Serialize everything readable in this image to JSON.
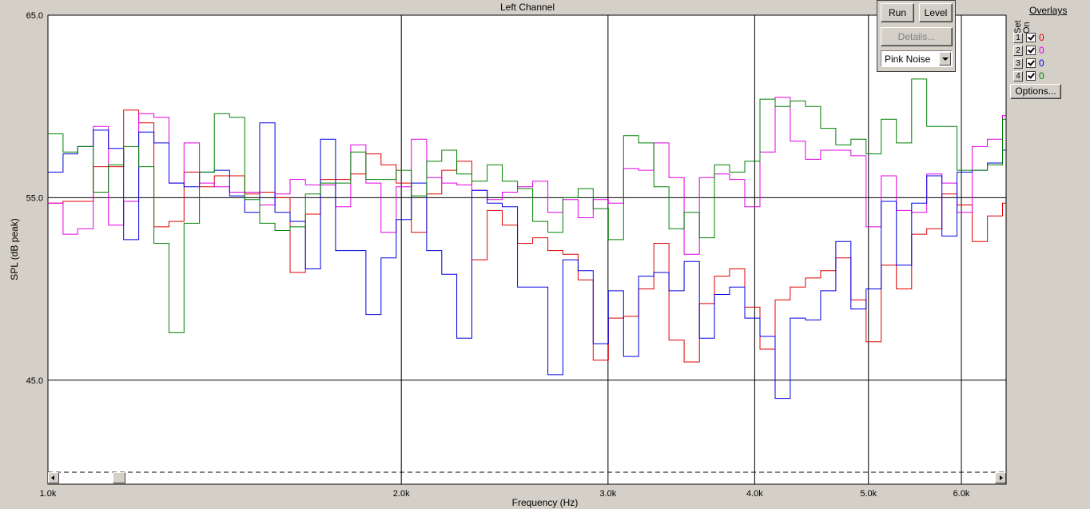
{
  "chart_title": "Left Channel",
  "controls": {
    "run_label": "Run",
    "level_label": "Level",
    "details_label": "Details...",
    "signal_value": "Pink Noise",
    "options_label": "Options..."
  },
  "overlays": {
    "title": "Overlays",
    "col_set": "Set",
    "col_on": "On",
    "rows": [
      {
        "num": "1",
        "count": "0",
        "color": "#e00000"
      },
      {
        "num": "2",
        "count": "0",
        "color": "#e000e0"
      },
      {
        "num": "3",
        "count": "0",
        "color": "#0000e0"
      },
      {
        "num": "4",
        "count": "0",
        "color": "#008000"
      }
    ]
  },
  "chart_data": {
    "type": "line",
    "title": "Left Channel",
    "xlabel": "Frequency (Hz)",
    "ylabel": "SPL (dB peak)",
    "x_scale": "log",
    "xlim": [
      1000,
      6550
    ],
    "ylim": [
      40.0,
      65.0
    ],
    "y_ticks": [
      "65.0",
      "55.0",
      "45.0"
    ],
    "x_ticks": [
      {
        "value": 1000,
        "label": "1.0k"
      },
      {
        "value": 2000,
        "label": "2.0k"
      },
      {
        "value": 3000,
        "label": "3.0k"
      },
      {
        "value": 4000,
        "label": "4.0k"
      },
      {
        "value": 5000,
        "label": "5.0k"
      },
      {
        "value": 6000,
        "label": "6.0k"
      }
    ],
    "grid": true,
    "x": [
      1000,
      1030,
      1060,
      1093,
      1126,
      1160,
      1195,
      1231,
      1268,
      1306,
      1346,
      1386,
      1428,
      1471,
      1515,
      1561,
      1608,
      1657,
      1707,
      1758,
      1811,
      1866,
      1922,
      1980,
      2040,
      2102,
      2165,
      2230,
      2297,
      2367,
      2438,
      2512,
      2588,
      2666,
      2746,
      2829,
      2914,
      3002,
      3093,
      3186,
      3282,
      3381,
      3483,
      3589,
      3697,
      3808,
      3923,
      4042,
      4164,
      4289,
      4419,
      4552,
      4690,
      4831,
      4977,
      5127,
      5282,
      5442,
      5606,
      5775,
      5949,
      6129,
      6314,
      6504
    ],
    "series": [
      {
        "name": "1",
        "color": "#e00000",
        "values": [
          54.7,
          54.8,
          54.8,
          56.7,
          56.7,
          59.8,
          59.1,
          53.4,
          53.7,
          56.4,
          55.6,
          56.2,
          56.2,
          55.2,
          55.3,
          55.0,
          50.9,
          54.1,
          56.0,
          56.0,
          56.3,
          57.4,
          56.8,
          55.8,
          53.1,
          55.2,
          56.5,
          57.0,
          51.6,
          54.3,
          53.5,
          52.5,
          52.8,
          52.1,
          51.9,
          50.5,
          46.1,
          48.4,
          48.5,
          50.0,
          52.5,
          47.2,
          46.0,
          49.2,
          50.7,
          51.1,
          49.0,
          46.7,
          49.4,
          50.1,
          50.6,
          51.0,
          51.7,
          49.4,
          47.1,
          51.3,
          50.0,
          53.0,
          53.3,
          55.2,
          54.6,
          52.6,
          54.0,
          54.7,
          55.1,
          56.6,
          57.1,
          57.6
        ]
      },
      {
        "name": "2",
        "color": "#e000e0",
        "values": [
          54.7,
          53.0,
          53.3,
          58.9,
          53.5,
          54.8,
          59.6,
          59.4,
          55.8,
          58.0,
          55.8,
          55.6,
          55.3,
          55.3,
          54.6,
          55.2,
          56.0,
          55.7,
          55.7,
          54.5,
          57.9,
          55.8,
          53.1,
          55.6,
          58.2,
          56.1,
          55.8,
          55.7,
          55.4,
          54.9,
          55.3,
          55.6,
          55.9,
          54.2,
          54.9,
          53.9,
          54.9,
          54.7,
          56.6,
          56.5,
          58.0,
          56.1,
          51.9,
          56.1,
          56.3,
          56.0,
          54.5,
          57.5,
          60.5,
          58.1,
          57.1,
          57.6,
          57.6,
          57.3,
          53.4,
          56.2,
          54.3,
          54.2,
          56.3,
          55.8,
          54.2,
          57.8,
          58.2,
          59.5,
          60.6,
          60.7,
          59.3
        ]
      },
      {
        "name": "3",
        "color": "#0000e0",
        "values": [
          56.4,
          57.4,
          57.8,
          58.7,
          57.7,
          52.7,
          58.6,
          58.0,
          55.8,
          55.6,
          56.4,
          56.5,
          55.1,
          54.2,
          59.1,
          54.2,
          53.7,
          51.1,
          58.2,
          52.1,
          52.1,
          48.6,
          51.7,
          53.8,
          55.8,
          52.1,
          50.8,
          47.3,
          55.4,
          54.7,
          54.5,
          50.1,
          50.1,
          45.3,
          51.6,
          51.0,
          47.0,
          49.9,
          46.3,
          50.7,
          50.9,
          49.9,
          51.5,
          47.3,
          49.7,
          50.1,
          48.4,
          47.4,
          44.0,
          48.4,
          48.3,
          49.9,
          52.6,
          48.9,
          50.0,
          54.8,
          51.3,
          54.7,
          56.2,
          52.9,
          56.4,
          56.5,
          56.9,
          57.6,
          56.3,
          58.9,
          59.2,
          60.7,
          62.4,
          60.5
        ]
      },
      {
        "name": "4",
        "color": "#008000",
        "values": [
          58.5,
          57.5,
          57.8,
          55.3,
          56.8,
          57.8,
          56.7,
          52.5,
          47.6,
          53.6,
          56.4,
          59.6,
          59.4,
          54.9,
          53.6,
          53.2,
          53.4,
          55.2,
          55.8,
          55.8,
          57.5,
          56.0,
          56.0,
          56.5,
          55.1,
          57.0,
          57.6,
          56.3,
          55.9,
          56.8,
          55.9,
          55.5,
          53.7,
          53.1,
          55.0,
          55.5,
          54.4,
          52.7,
          58.4,
          58.0,
          55.6,
          53.3,
          54.2,
          52.8,
          56.8,
          56.4,
          57.0,
          60.4,
          60.0,
          60.3,
          60.0,
          58.8,
          57.9,
          58.2,
          57.4,
          59.3,
          58.0,
          61.5,
          58.9,
          58.9,
          56.5,
          56.5,
          56.8,
          59.3,
          61.2,
          61.3,
          60.5
        ]
      }
    ]
  }
}
